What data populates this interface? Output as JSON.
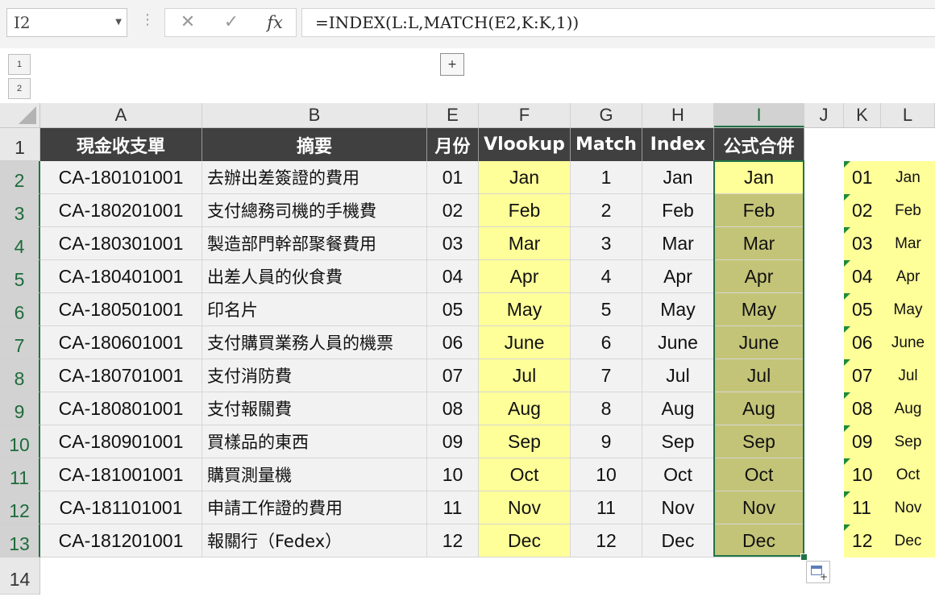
{
  "formula_bar": {
    "name_box": "I2",
    "more_glyph": "⋮",
    "cancel_glyph": "✕",
    "enter_glyph": "✓",
    "fx_label": "fx",
    "formula": "=INDEX(L:L,MATCH(E2,K:K,1))"
  },
  "outline": {
    "levels": [
      "1",
      "2"
    ],
    "expand_label": "+"
  },
  "columns": [
    "A",
    "B",
    "E",
    "F",
    "G",
    "H",
    "I",
    "J",
    "K",
    "L"
  ],
  "active_column": "I",
  "rows": [
    "1",
    "2",
    "3",
    "4",
    "5",
    "6",
    "7",
    "8",
    "9",
    "10",
    "11",
    "12",
    "13",
    "14"
  ],
  "headers": [
    "現金收支單",
    "摘要",
    "月份",
    "Vlookup",
    "Match",
    "Index",
    "公式合併"
  ],
  "table": [
    {
      "a": "CA-180101001",
      "b": "去辦出差簽證的費用",
      "e": "01",
      "f": "Jan",
      "g": "1",
      "h": "Jan",
      "i": "Jan"
    },
    {
      "a": "CA-180201001",
      "b": "支付總務司機的手機費",
      "e": "02",
      "f": "Feb",
      "g": "2",
      "h": "Feb",
      "i": "Feb"
    },
    {
      "a": "CA-180301001",
      "b": "製造部門幹部聚餐費用",
      "e": "03",
      "f": "Mar",
      "g": "3",
      "h": "Mar",
      "i": "Mar"
    },
    {
      "a": "CA-180401001",
      "b": "出差人員的伙食費",
      "e": "04",
      "f": "Apr",
      "g": "4",
      "h": "Apr",
      "i": "Apr"
    },
    {
      "a": "CA-180501001",
      "b": "印名片",
      "e": "05",
      "f": "May",
      "g": "5",
      "h": "May",
      "i": "May"
    },
    {
      "a": "CA-180601001",
      "b": "支付購買業務人員的機票",
      "e": "06",
      "f": "June",
      "g": "6",
      "h": "June",
      "i": "June"
    },
    {
      "a": "CA-180701001",
      "b": "支付消防費",
      "e": "07",
      "f": "Jul",
      "g": "7",
      "h": "Jul",
      "i": "Jul"
    },
    {
      "a": "CA-180801001",
      "b": "支付報關費",
      "e": "08",
      "f": "Aug",
      "g": "8",
      "h": "Aug",
      "i": "Aug"
    },
    {
      "a": "CA-180901001",
      "b": "買樣品的東西",
      "e": "09",
      "f": "Sep",
      "g": "9",
      "h": "Sep",
      "i": "Sep"
    },
    {
      "a": "CA-181001001",
      "b": "購買測量機",
      "e": "10",
      "f": "Oct",
      "g": "10",
      "h": "Oct",
      "i": "Oct"
    },
    {
      "a": "CA-181101001",
      "b": "申請工作證的費用",
      "e": "11",
      "f": "Nov",
      "g": "11",
      "h": "Nov",
      "i": "Nov"
    },
    {
      "a": "CA-181201001",
      "b": "報關行（Fedex）",
      "e": "12",
      "f": "Dec",
      "g": "12",
      "h": "Dec",
      "i": "Dec"
    }
  ],
  "lookup": [
    {
      "k": "01",
      "l": "Jan"
    },
    {
      "k": "02",
      "l": "Feb"
    },
    {
      "k": "03",
      "l": "Mar"
    },
    {
      "k": "04",
      "l": "Apr"
    },
    {
      "k": "05",
      "l": "May"
    },
    {
      "k": "06",
      "l": "June"
    },
    {
      "k": "07",
      "l": "Jul"
    },
    {
      "k": "08",
      "l": "Aug"
    },
    {
      "k": "09",
      "l": "Sep"
    },
    {
      "k": "10",
      "l": "Oct"
    },
    {
      "k": "11",
      "l": "Nov"
    },
    {
      "k": "12",
      "l": "Dec"
    }
  ],
  "colors": {
    "header_bg": "#404040",
    "vlookup_fill": "#ffff99",
    "merge_fill": "#c4c478",
    "selection": "#217346"
  }
}
